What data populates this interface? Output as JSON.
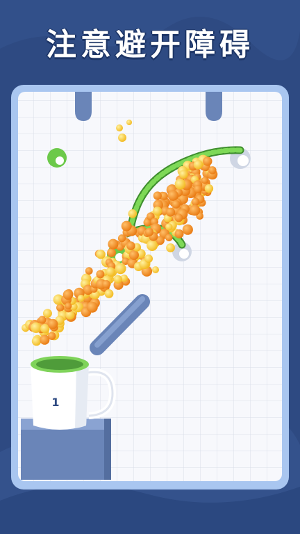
{
  "banner": {
    "title": "注意避开障碍"
  },
  "cup": {
    "number": "1"
  },
  "colors": {
    "background": "#2e4a82",
    "board_frame": "#a9c6f0",
    "board_fill": "#f7f8fc",
    "grid_line": "#d9dee9",
    "peg_green": "#6cc94a",
    "rope_green": "#7ed957",
    "ball_orange": "#f28a1e",
    "ball_yellow": "#f7c52a",
    "obstacle": "#6a85b8",
    "cup_rim": "#7fd35a"
  }
}
